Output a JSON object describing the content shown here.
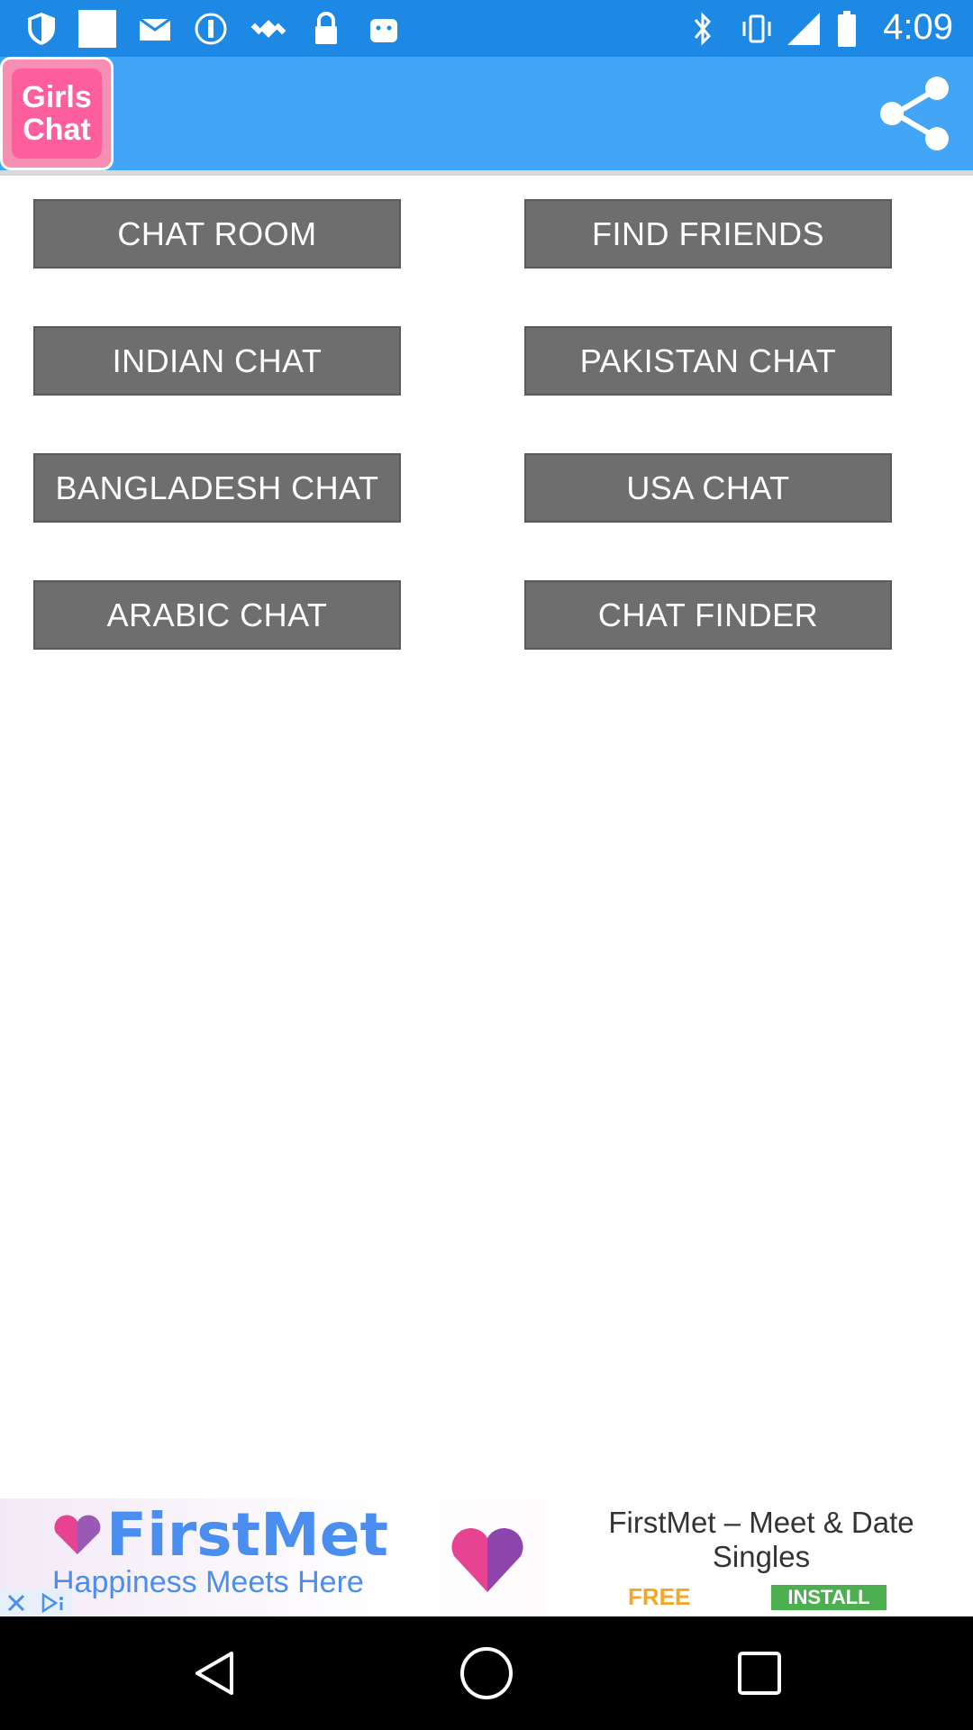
{
  "status_bar": {
    "time": "4:09",
    "icons": [
      "shield-icon",
      "notification-square-icon",
      "mail-icon",
      "info-icon",
      "satellite-icon",
      "lock-icon",
      "android-icon"
    ],
    "right_icons": [
      "bluetooth-icon",
      "vibrate-icon",
      "signal-icon",
      "battery-icon"
    ]
  },
  "app_bar": {
    "logo_line1": "Girls",
    "logo_line2": "Chat",
    "share_icon": "share-icon",
    "colors": {
      "bar": "#42a5f5",
      "logo": "#ff5e9e"
    }
  },
  "menu": {
    "chat_room": "CHAT ROOM",
    "find_friends": "FIND FRIENDS",
    "indian_chat": "INDIAN CHAT",
    "pakistan_chat": "PAKISTAN CHAT",
    "bangladesh_chat": "BANGLADESH CHAT",
    "usa_chat": "USA CHAT",
    "arabic_chat": "ARABIC CHAT",
    "chat_finder": "CHAT FINDER",
    "button_color": "#6e6e6e"
  },
  "ad": {
    "brand": "FirstMet",
    "tagline": "Happiness Meets Here",
    "title": "FirstMet – Meet & Date Singles",
    "free_label": "FREE",
    "install_label": "INSTALL"
  },
  "nav": {
    "icons": [
      "back-icon",
      "home-icon",
      "recents-icon"
    ]
  }
}
